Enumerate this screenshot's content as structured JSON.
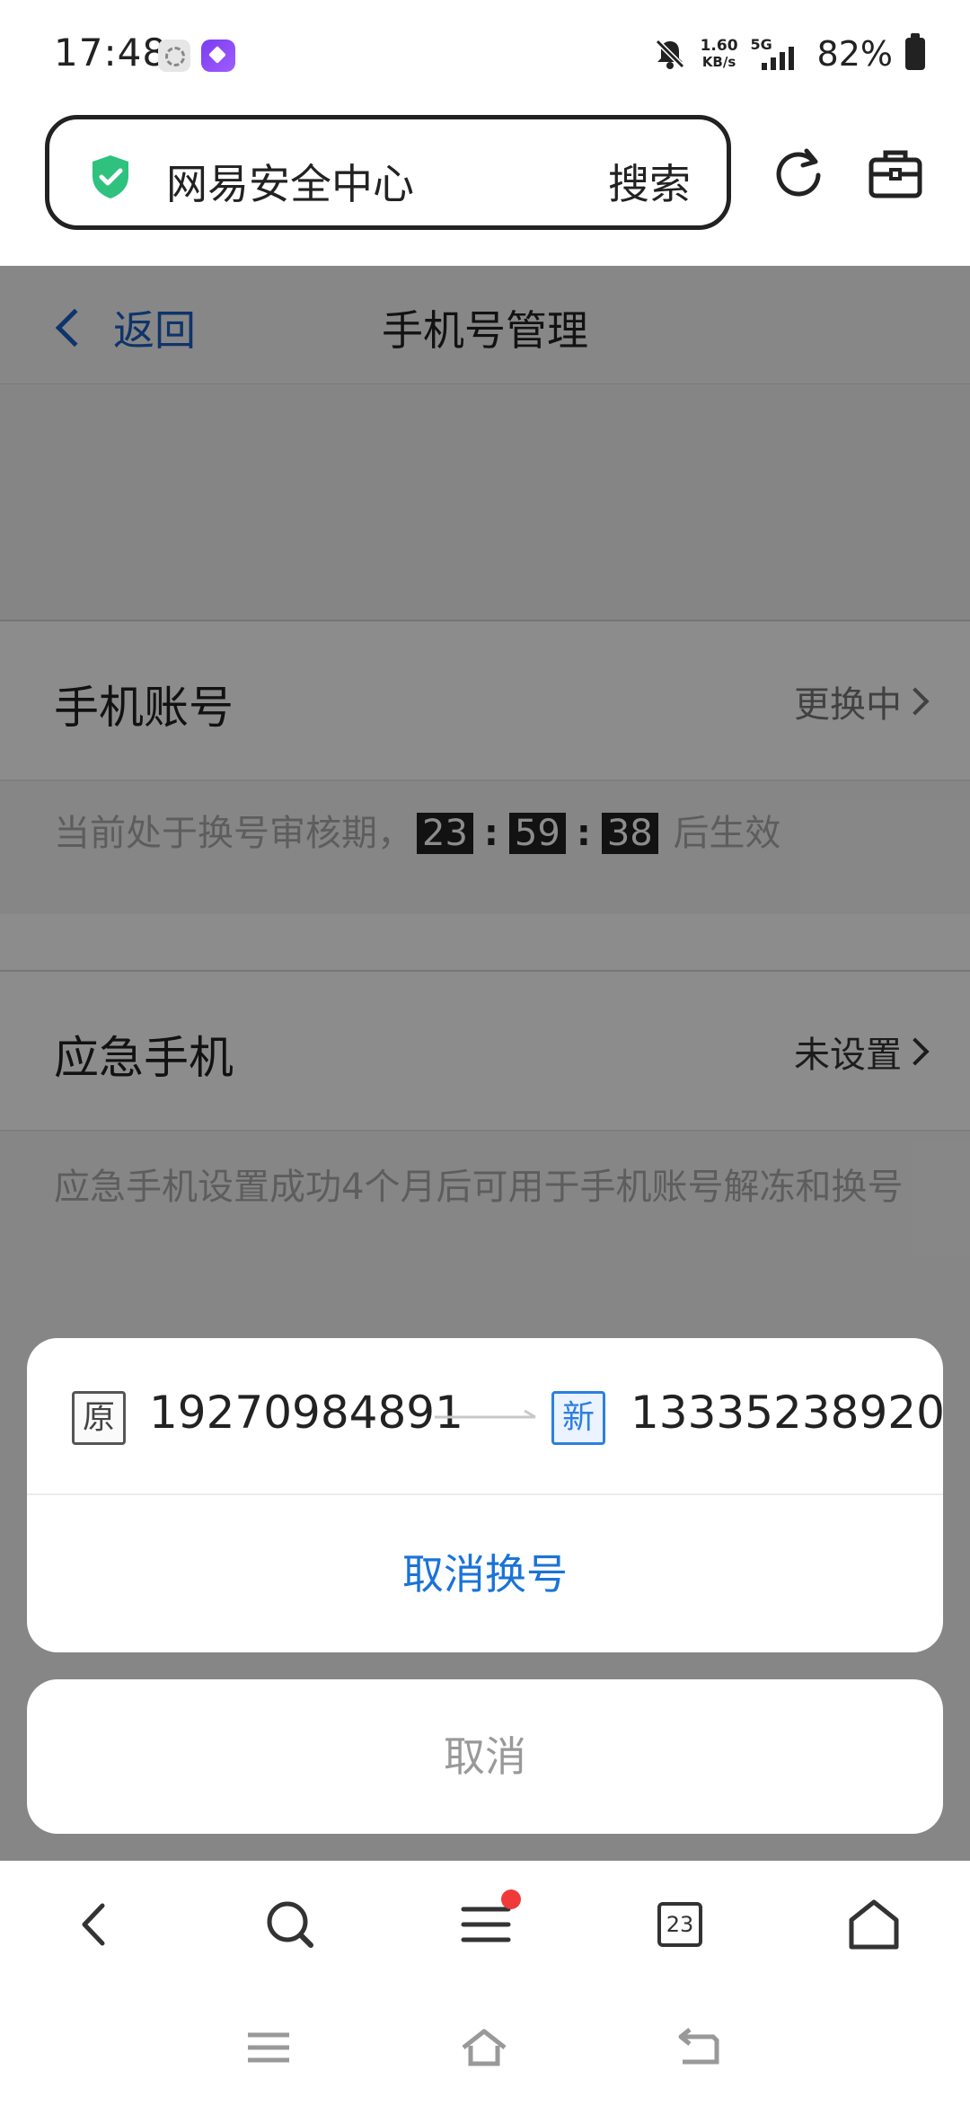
{
  "status_bar": {
    "time": "17:48",
    "net_speed_value": "1.60",
    "net_speed_unit": "KB/s",
    "network_type": "5G",
    "battery": "82%",
    "icons": [
      "settings-app-icon",
      "purple-app-icon",
      "silent-bell-icon",
      "signal-icon",
      "battery-icon"
    ]
  },
  "browser": {
    "site_name": "网易安全中心",
    "search_label": "搜索",
    "icons": [
      "shield-check-icon",
      "reload-icon",
      "toolbox-icon"
    ]
  },
  "page": {
    "back_label": "返回",
    "title": "手机号管理",
    "phone_account": {
      "label": "手机账号",
      "status": "更换中",
      "review_prefix": "当前处于换号审核期，",
      "countdown_hours": "23",
      "countdown_minutes": "59",
      "countdown_seconds": "38",
      "review_suffix": "后生效"
    },
    "emergency_phone": {
      "label": "应急手机",
      "status": "未设置",
      "description": "应急手机设置成功4个月后可用于手机账号解冻和换号"
    }
  },
  "action_sheet": {
    "old_tag": "原",
    "old_number": "19270984891",
    "new_tag": "新",
    "new_number": "13335238920",
    "cancel_swap_label": "取消换号",
    "cancel_label": "取消"
  },
  "bottom_nav": {
    "tabs_count": "23",
    "icons": [
      "back-icon",
      "search-icon",
      "menu-icon",
      "tabs-icon",
      "home-icon"
    ]
  },
  "colors": {
    "link_blue": "#1a5fc4",
    "action_blue": "#1a73d8",
    "shield_green": "#2ec27e",
    "notification_red": "#f03a3a"
  }
}
